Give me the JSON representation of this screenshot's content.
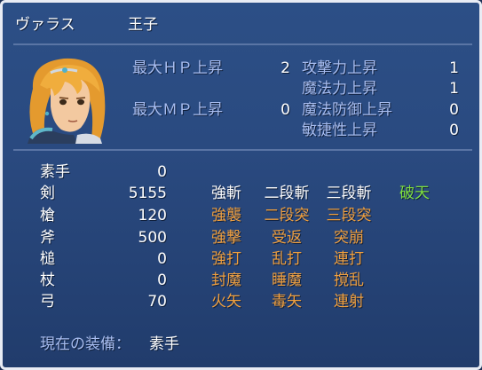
{
  "header": {
    "name": "ヴァラス",
    "class": "王子"
  },
  "stats_left": [
    {
      "label": "最大ＨＰ上昇",
      "value": "2"
    },
    {
      "label": "最大ＭＰ上昇",
      "value": "0"
    }
  ],
  "stats_right": [
    {
      "label": "攻撃力上昇",
      "value": "1"
    },
    {
      "label": "魔法力上昇",
      "value": "1"
    },
    {
      "label": "魔法防御上昇",
      "value": "0"
    },
    {
      "label": "敏捷性上昇",
      "value": "0"
    }
  ],
  "weapons": [
    {
      "name": "素手",
      "exp": "0",
      "skills": []
    },
    {
      "name": "剣",
      "exp": "5155",
      "skills": [
        "強斬",
        "二段斬",
        "三段斬",
        "破天"
      ]
    },
    {
      "name": "槍",
      "exp": "120",
      "skills": [
        "強襲",
        "二段突",
        "三段突"
      ]
    },
    {
      "name": "斧",
      "exp": "500",
      "skills": [
        "強撃",
        "受返",
        "突崩"
      ]
    },
    {
      "name": "槌",
      "exp": "0",
      "skills": [
        "強打",
        "乱打",
        "連打"
      ]
    },
    {
      "name": "杖",
      "exp": "0",
      "skills": [
        "封魔",
        "睡魔",
        "撹乱"
      ]
    },
    {
      "name": "弓",
      "exp": "70",
      "skills": [
        "火矢",
        "毒矢",
        "連射"
      ]
    }
  ],
  "equipment": {
    "label": "現在の装備：",
    "value": "素手"
  },
  "colors": {
    "stat_label": "#a8bdf0",
    "skill_learned": "#ffffff",
    "skill_unlearned": "#f0a040",
    "skill_special": "#7fe040"
  }
}
